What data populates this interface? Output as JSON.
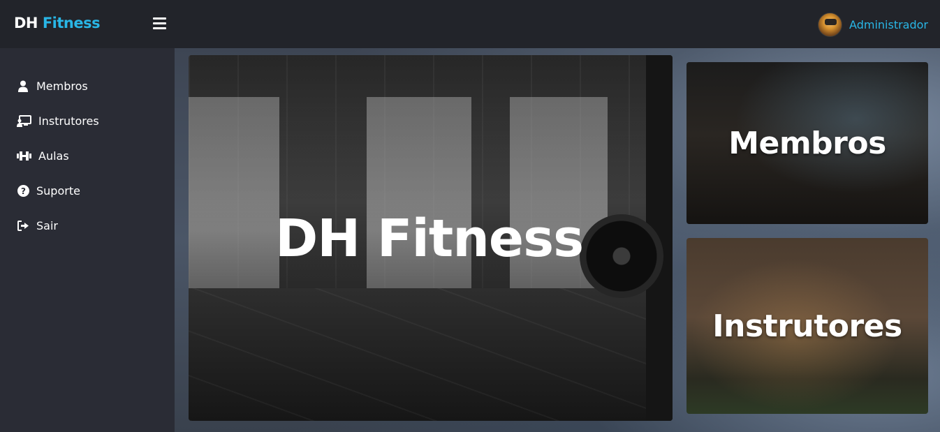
{
  "header": {
    "brand_part1": "DH",
    "brand_part2": "Fitness",
    "menu_icon": "hamburger-icon",
    "user": {
      "name": "Administrador",
      "avatar": "user-avatar"
    }
  },
  "sidebar": {
    "items": [
      {
        "label": "Membros",
        "icon": "user-icon"
      },
      {
        "label": "Instrutores",
        "icon": "presentation-icon"
      },
      {
        "label": "Aulas",
        "icon": "dumbbell-icon"
      },
      {
        "label": "Suporte",
        "icon": "question-circle-icon"
      },
      {
        "label": "Sair",
        "icon": "sign-out-icon"
      }
    ]
  },
  "main": {
    "hero_title": "DH Fitness",
    "cards": [
      {
        "title": "Membros"
      },
      {
        "title": "Instrutores"
      }
    ]
  },
  "colors": {
    "accent": "#29b6e6",
    "topbar": "#22242a",
    "sidebar": "#2a2c35"
  }
}
